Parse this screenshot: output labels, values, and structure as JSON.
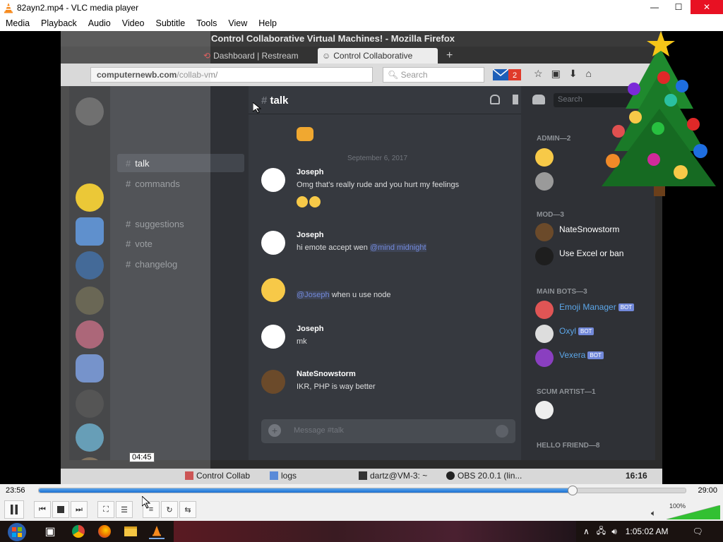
{
  "window": {
    "title": "82ayn2.mp4 - VLC media player"
  },
  "menu": [
    "Media",
    "Playback",
    "Audio",
    "Video",
    "Subtitle",
    "Tools",
    "View",
    "Help"
  ],
  "firefox": {
    "title": "Control Collaborative Virtual Machines! - Mozilla Firefox",
    "tabs": [
      "Dashboard | Restream",
      "Control Collaborative"
    ],
    "url_host": "computernewb.com",
    "url_path": "/collab-vm/",
    "search_placeholder": "Search",
    "mail_count": "2"
  },
  "discord": {
    "channel_name": "talk",
    "search_placeholder": "Search",
    "channels": [
      "talk",
      "commands",
      "suggestions",
      "vote",
      "changelog"
    ],
    "active_channel": "talk",
    "date_separator": "September 6, 2017",
    "messages": [
      {
        "author": "Joseph",
        "text": "Omg that's really rude and you hurt my feelings"
      },
      {
        "author": "Joseph",
        "text_before": "hi emote accept wen ",
        "mention": "@mind midnight"
      },
      {
        "author": "",
        "mention": "@Joseph",
        "text_after": " when u use node"
      },
      {
        "author": "Joseph",
        "text": "mk"
      },
      {
        "author": "NateSnowstorm",
        "text": "IKR, PHP is way better"
      }
    ],
    "composer_placeholder": "Message #talk",
    "member_groups": [
      {
        "title": "ADMIN—2",
        "members": []
      },
      {
        "title": "MOD—3",
        "members": [
          "NateSnowstorm",
          "Use Excel or ban"
        ]
      },
      {
        "title": "MAIN BOTS—3",
        "members": [
          "Emoji Manager",
          "Oxyl",
          "Vexera"
        ]
      },
      {
        "title": "SCUM ARTIST—1",
        "members": []
      },
      {
        "title": "HELLO FRIEND—8",
        "members": []
      }
    ],
    "bot_badge": "BOT"
  },
  "inner_taskbar": {
    "items": [
      "Control Collab",
      "logs",
      "dartz@VM-3: ~",
      "OBS 20.0.1 (lin..."
    ],
    "clock": "16:16"
  },
  "player": {
    "hover_time": "04:45",
    "current_time": "23:56",
    "total_time": "29:00",
    "progress": 0.8255,
    "volume_label": "100%",
    "volume": 1.0
  },
  "taskbar": {
    "clock": "1:05:02 AM"
  }
}
